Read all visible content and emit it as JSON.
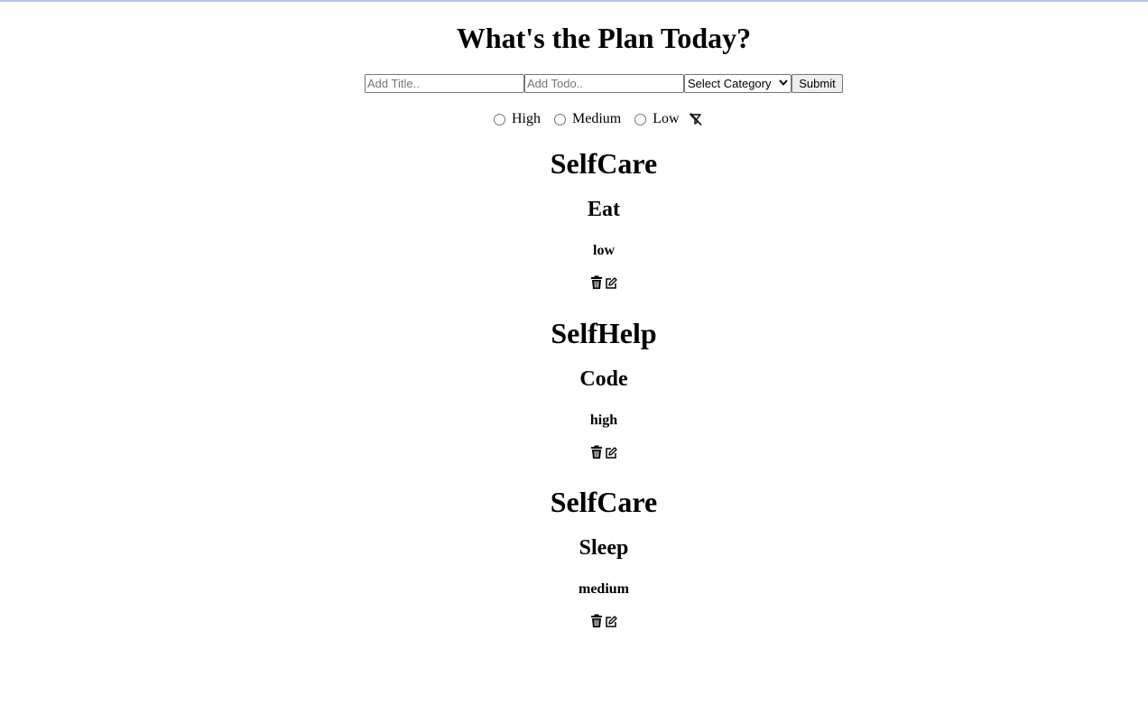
{
  "header": {
    "title": "What's the Plan Today?"
  },
  "form": {
    "title_placeholder": "Add Title..",
    "todo_placeholder": "Add Todo..",
    "category_selected": "Select Category",
    "submit_label": "Submit"
  },
  "filters": {
    "options": [
      {
        "label": "High"
      },
      {
        "label": "Medium"
      },
      {
        "label": "Low"
      }
    ],
    "clear_icon": "filter-off-icon"
  },
  "todos": [
    {
      "category": "SelfCare",
      "title": "Eat",
      "priority": "low"
    },
    {
      "category": "SelfHelp",
      "title": "Code",
      "priority": "high"
    },
    {
      "category": "SelfCare",
      "title": "Sleep",
      "priority": "medium"
    }
  ],
  "icons": {
    "delete": "trash-icon",
    "edit": "edit-icon"
  }
}
